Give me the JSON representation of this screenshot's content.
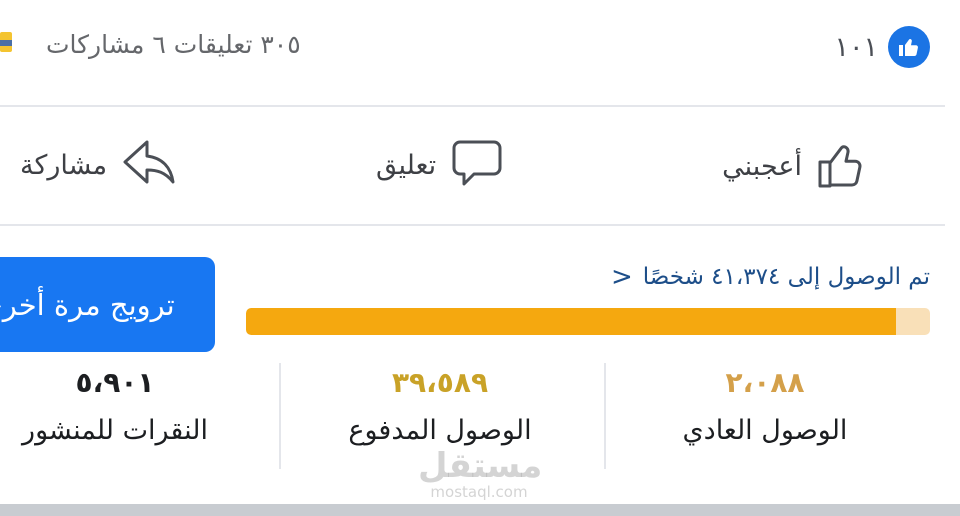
{
  "reactions": {
    "like_count": "١٠١",
    "stats_text": "٣٠٥ تعليقات ٦ مشاركات"
  },
  "actions": {
    "like_label": "أعجبني",
    "comment_label": "تعليق",
    "share_label": "مشاركة"
  },
  "promotion": {
    "reach_text": "تم الوصول إلى ٤١،٣٧٤ شخصًا",
    "reach_chevron": "<",
    "promote_button_label": "ترويج مرة أخرى",
    "paid_reach_fraction": 0.95
  },
  "metrics": [
    {
      "label": "الوصول العادي",
      "value": "٢،٠٨٨"
    },
    {
      "label": "الوصول المدفوع",
      "value": "٣٩،٥٨٩"
    },
    {
      "label": "النقرات للمنشور",
      "value": "٥،٩٠١"
    }
  ],
  "watermark": {
    "arabic": "مستقل",
    "latin": "mostaql.com"
  },
  "colors": {
    "brand_blue": "#1877f2",
    "reach_bar_paid": "#f5a80f",
    "reach_bar_organic": "#f9e0b8",
    "link_blue": "#1d4e89"
  }
}
